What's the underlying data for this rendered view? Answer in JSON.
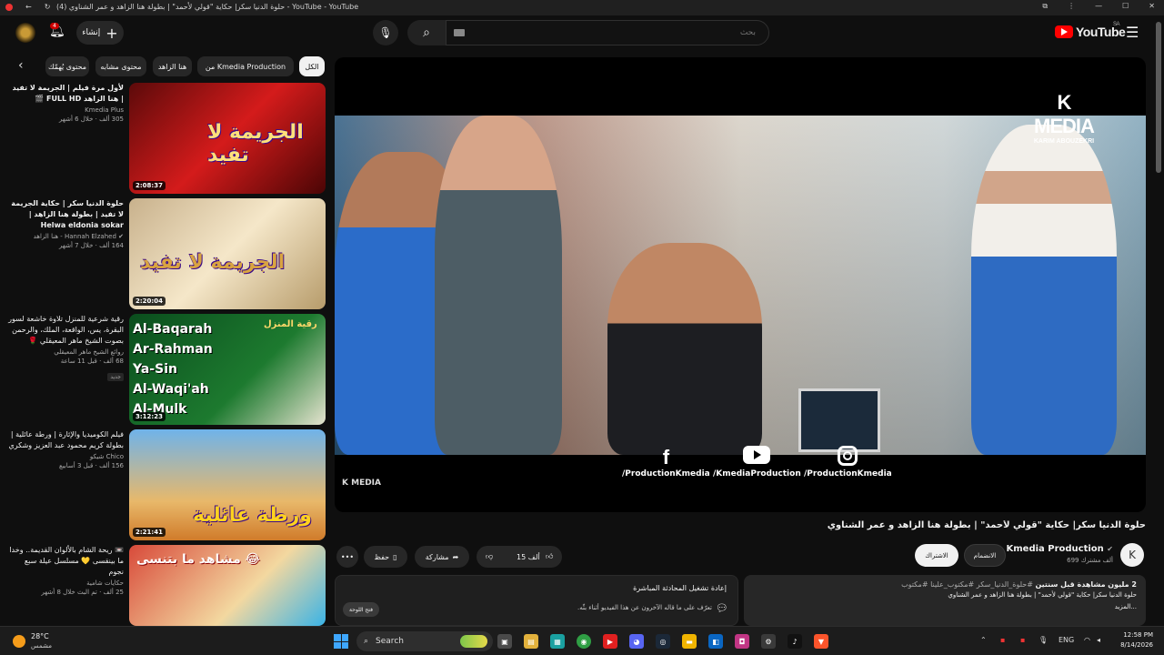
{
  "window": {
    "title": "حلوة الدنيا سكر| حكاية \"قولي لأحمد\" | بطولة هنا الزاهد و عمر الشناوي (4) - YouTube - YouTube"
  },
  "masthead": {
    "notification_count": "4",
    "create_label": "إنشاء",
    "search_placeholder": "بحث",
    "logo_text": "YouTube",
    "region": "SA"
  },
  "chips": {
    "items": [
      "الكل",
      "من Kmedia Production",
      "هنا الزاهد",
      "محتوى مشابه",
      "محتوى يُهمّك"
    ]
  },
  "recommendations": [
    {
      "title": "لأول مرة فيلم | الجريمة لا تفيد | هنا الزاهد FULL HD 🎬",
      "channel": "Kmedia Plus",
      "stats": "305 ألف · خلال 6 أشهر",
      "duration": "2:08:37",
      "thumb_text": "الجريمة لا تفيد"
    },
    {
      "title": "حلوة الدنيا سكر | حكاية الجريمة لا تفيد | بطولة هنا الزاهد | Helwa eldonia sokar",
      "channel": "Hannah Elzahed - هنا الزاهد",
      "stats": "164 ألف · خلال 7 أشهر",
      "duration": "2:20:04",
      "thumb_text": "الجريمة لا تفيد"
    },
    {
      "title": "رقية شرعية للمنزل   تلاوة خاشعة لسور البقرة، يس، الواقعة، الملك، والرحمن بصوت الشيخ ماهر المعيقلي 🌹",
      "channel": "روائع الشيخ ماهر المعيقلي",
      "stats": "68 ألف · قبل 11 ساعة",
      "badge": "جديد",
      "duration": "3:12:23",
      "thumb_title": "رقية المنزل",
      "thumb_surahs": [
        "Al-Baqarah",
        "Ar-Rahman",
        "Ya-Sin",
        "Al-Waqi'ah",
        "Al-Mulk"
      ]
    },
    {
      "title": "فيلم الكوميديا والإثارة | ورطة عائلية | بطولة كريم محمود عبد العزيز وشكري",
      "channel": "Chico شيكو",
      "stats": "156 ألف · قبل 3 أسابيع",
      "duration": "2:21:41",
      "thumb_text": "ورطة عائلية"
    },
    {
      "title": "📼 ريحة الشام بالألوان القديمة.. وخدا ما بينقسى 💛 مسلسل عيلة سبع نجوم",
      "channel": "حكايات شامية",
      "stats": "25 ألف · تم البث خلال 8 أشهر",
      "thumb_text": "مشاهد ما بتنسى 😂"
    }
  ],
  "player": {
    "logo_mark": "K MEDIA",
    "logo_name": "KARIM ABOUZEKRI",
    "socials": [
      {
        "icon": "f",
        "handle": "/ProductionKmedia"
      },
      {
        "icon": "youtube",
        "handle": "/KmediaProduction"
      },
      {
        "icon": "instagram",
        "handle": "/ProductionKmedia"
      }
    ],
    "watermark": "K MEDIA"
  },
  "video": {
    "title": "حلوة الدنيا سكر| حكاية \"قولي لأحمد\" | بطولة هنا الزاهد و عمر الشناوي",
    "channel": "Kmedia Production",
    "subscribers": "699 ألف مشترك",
    "join_label": "الانضمام",
    "subscribe_label": "الاشتراك",
    "like_count": "15 ألف",
    "share_label": "مشاركة",
    "save_label": "حفظ",
    "description": {
      "views": "2 مليون مشاهدة  قبل سنتين",
      "hashtags": "#حلوة_الدنيا_سكر #مكتوب_علينا #مكتوب",
      "text": "حلوة الدنيا سكر| حكاية \"قولي لأحمد\" | بطولة هنا الزاهد و عمر الشناوي",
      "more": "...المزيد"
    }
  },
  "chat": {
    "title": "إعادة تشغيل المحادثة المباشرة",
    "message": "تعرّف على ما قاله الآخرون عن هذا الفيديو أثناء بثّه.",
    "button": "فتح اللوحة"
  },
  "taskbar": {
    "temperature": "28°C",
    "condition": "مشمس",
    "search_label": "Search",
    "language": "ENG",
    "time": "12:58 PM",
    "date": "8/14/2026"
  }
}
